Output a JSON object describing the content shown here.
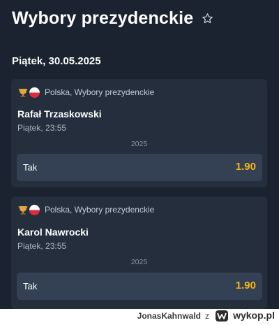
{
  "header": {
    "title": "Wybory prezydenckie",
    "favorite_icon": "star-outline-icon"
  },
  "date_heading": "Piątek, 30.05.2025",
  "events": [
    {
      "league": "Polska, Wybory prezydenckie",
      "icons": [
        "trophy-icon",
        "poland-flag-icon"
      ],
      "player": "Rafał Trzaskowski",
      "time": "Piątek, 23:55",
      "year": "2025",
      "option_label": "Tak",
      "odds": "1.90"
    },
    {
      "league": "Polska, Wybory prezydenckie",
      "icons": [
        "trophy-icon",
        "poland-flag-icon"
      ],
      "player": "Karol Nawrocki",
      "time": "Piątek, 23:55",
      "year": "2025",
      "option_label": "Tak",
      "odds": "1.90"
    }
  ],
  "footer": {
    "user": "JonasKahnwald",
    "connector": "z",
    "brand": "wykop.pl",
    "logo_icon": "wykop-logo-icon"
  },
  "colors": {
    "background": "#1b2330",
    "card": "#242e3c",
    "odds_button": "#344154",
    "odds_value": "#f5b416"
  }
}
